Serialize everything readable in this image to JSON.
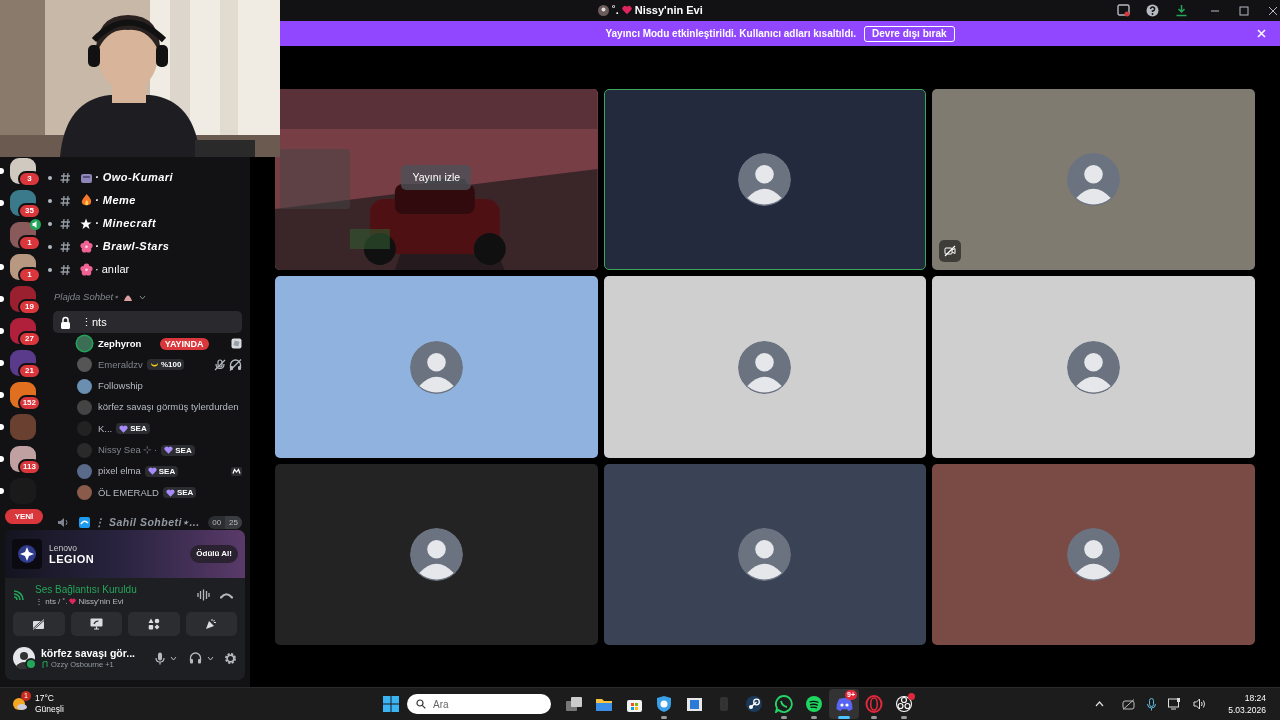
{
  "window": {
    "title_prefix": "˚.",
    "title": "Nissy'nin Evi"
  },
  "banner": {
    "message": "Yayıncı Modu etkinleştirildi. Kullanıcı adları kısaltıldı.",
    "button": "Devre dışı bırak"
  },
  "servers": [
    {
      "badge": "3",
      "unread": true,
      "voice": false,
      "color": "#cfc9c0"
    },
    {
      "badge": "35",
      "unread": true,
      "voice": false,
      "color": "#3a7a8a"
    },
    {
      "badge": "1",
      "unread": false,
      "voice": true,
      "color": "#8a5a5a"
    },
    {
      "badge": "1",
      "unread": true,
      "voice": false,
      "color": "#b89880"
    },
    {
      "badge": "19",
      "unread": true,
      "voice": false,
      "color": "#9a2030"
    },
    {
      "badge": "27",
      "unread": true,
      "voice": false,
      "color": "#b0203a"
    },
    {
      "badge": "21",
      "unread": true,
      "voice": false,
      "color": "#5a3a8a"
    },
    {
      "badge": "152",
      "unread": true,
      "voice": false,
      "color": "#e07020"
    },
    {
      "unread": true,
      "voice": false,
      "color": "#6a4030"
    },
    {
      "badge": "113",
      "unread": true,
      "voice": false,
      "color": "#c0a0a0"
    },
    {
      "unread": true,
      "voice": false,
      "color": "#1a1a1a"
    }
  ],
  "new_pill": "YENİ",
  "channels": [
    {
      "name": "· Owo-Kumari",
      "kind": "box",
      "bold": true
    },
    {
      "name": "· Meme",
      "kind": "fire",
      "bold": true
    },
    {
      "name": "· Minecraft",
      "kind": "star",
      "bold": true
    },
    {
      "name": "· Brawl-Stars",
      "kind": "flower",
      "bold": true
    },
    {
      "name": "· anılar",
      "kind": "flower",
      "bold": false
    }
  ],
  "category": {
    "name": "Plajda Sohbet⋆",
    "expanded": true
  },
  "voice_channel": {
    "name": "⋮nts",
    "locked": true,
    "selected": true,
    "members": [
      {
        "name": "Zephyron",
        "speaking": true,
        "dimmed": false,
        "badges": [
          {
            "kind": "live",
            "text": "YAYINDA"
          }
        ],
        "status_icons": [
          {
            "kind": "activity"
          }
        ]
      },
      {
        "name": "Emeraldzv",
        "speaking": false,
        "dimmed": true,
        "badges": [
          {
            "kind": "moon",
            "text": "%100"
          }
        ],
        "status_icons": [
          {
            "kind": "mic-off"
          },
          {
            "kind": "headset-off"
          }
        ]
      },
      {
        "name": "Followship",
        "speaking": false,
        "dimmed": false
      },
      {
        "name": "körfez savaşı görmüş tylerdurden",
        "speaking": false,
        "dimmed": false
      },
      {
        "name": "K...",
        "speaking": false,
        "dimmed": false,
        "badges": [
          {
            "kind": "heart",
            "text": "SEA"
          }
        ]
      },
      {
        "name": "Nissy Sea ⊹ ·",
        "speaking": false,
        "dimmed": true,
        "badges": [
          {
            "kind": "heart",
            "text": "SEA"
          }
        ]
      },
      {
        "name": "pixel elma",
        "speaking": false,
        "dimmed": false,
        "badges": [
          {
            "kind": "heart",
            "text": "SEA"
          }
        ],
        "status_icons": [
          {
            "kind": "app"
          }
        ]
      },
      {
        "name": "ÖL EMERALD",
        "speaking": false,
        "dimmed": false,
        "badges": [
          {
            "kind": "heart",
            "text": "SEA"
          }
        ]
      }
    ]
  },
  "next_channel": {
    "name": "⋮ Sahil Sohbeti⋆...",
    "counts": [
      "00",
      "25"
    ]
  },
  "ad": {
    "brand": "Lenovo",
    "product": "LEGION",
    "button": "Ödülü Al!"
  },
  "voice_status": {
    "title": "Ses Bağlantısı Kuruldu",
    "path": "⋮ nts / ˚.",
    "server": "Nissy'nin Evi"
  },
  "user": {
    "name": "körfez savaşı gör...",
    "activity": "Ozzy Osbourne +1",
    "online": true
  },
  "tiles": [
    {
      "kind": "stream",
      "button": "Yayını izle",
      "speaking": false,
      "video_disabled": false
    },
    {
      "kind": "avatar",
      "color": "#232a3d",
      "speaking": true,
      "video_disabled": false
    },
    {
      "kind": "avatar",
      "color": "#7f7b70",
      "speaking": false,
      "video_disabled": true
    },
    {
      "kind": "avatar",
      "color": "#8fb3de",
      "speaking": false,
      "video_disabled": false
    },
    {
      "kind": "avatar",
      "color": "#cfcfcf",
      "speaking": false,
      "video_disabled": false
    },
    {
      "kind": "avatar",
      "color": "#cfcfcf",
      "speaking": false,
      "video_disabled": false
    },
    {
      "kind": "avatar",
      "color": "#232323",
      "speaking": false,
      "video_disabled": false
    },
    {
      "kind": "avatar",
      "color": "#3a4356",
      "speaking": false,
      "video_disabled": false
    },
    {
      "kind": "avatar",
      "color": "#7a4a44",
      "speaking": false,
      "video_disabled": false
    }
  ],
  "taskbar": {
    "weather": {
      "temp": "17°C",
      "desc": "Güneşli",
      "badge": "1"
    },
    "search_placeholder": "Ara",
    "apps": [
      {
        "kind": "taskview",
        "running": false,
        "selected": false,
        "alert": false
      },
      {
        "kind": "files",
        "running": false,
        "selected": false,
        "alert": false
      },
      {
        "kind": "store",
        "running": false,
        "selected": false,
        "alert": false
      },
      {
        "kind": "shield",
        "running": true,
        "selected": false,
        "alert": false
      },
      {
        "kind": "window",
        "running": false,
        "selected": false,
        "alert": false
      },
      {
        "kind": "phone",
        "running": false,
        "selected": false,
        "alert": false
      },
      {
        "kind": "steam",
        "running": false,
        "selected": false,
        "alert": false
      },
      {
        "kind": "whatsapp",
        "running": true,
        "selected": false,
        "alert": false
      },
      {
        "kind": "spotify",
        "running": true,
        "selected": false,
        "alert": false
      },
      {
        "kind": "discord",
        "running": true,
        "selected": true,
        "alert": false,
        "badge": "9+"
      },
      {
        "kind": "opera",
        "running": true,
        "selected": false,
        "alert": false
      },
      {
        "kind": "obs",
        "running": true,
        "selected": false,
        "alert": true
      }
    ],
    "time": "18:24",
    "date": "5.03.2026"
  }
}
